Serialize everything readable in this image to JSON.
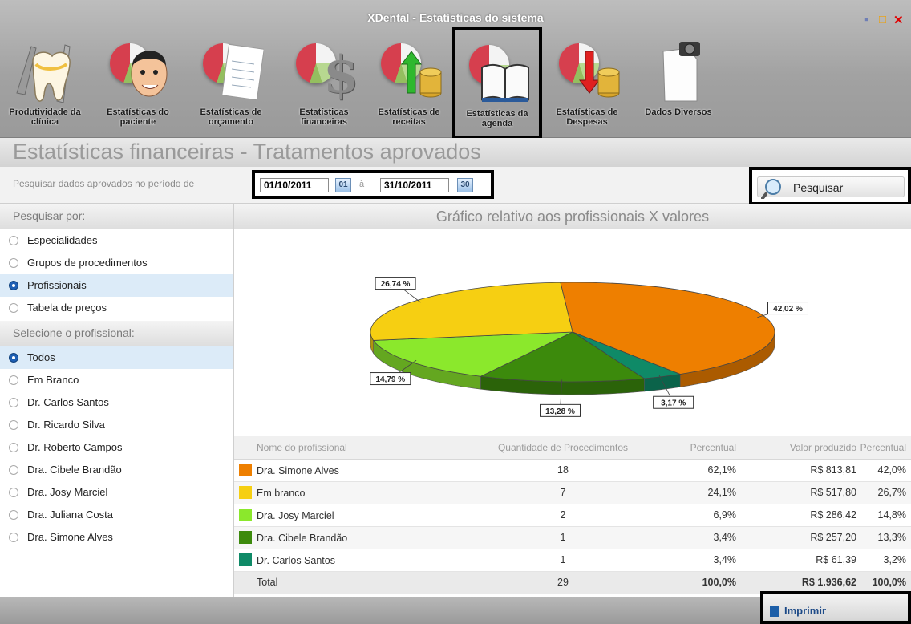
{
  "window": {
    "title": "XDental - Estatísticas do sistema"
  },
  "toolbar": {
    "items": [
      {
        "label": "Produtividade da clínica",
        "icon": "tooth-dental-icon"
      },
      {
        "label": "Estatísticas do paciente",
        "icon": "pie-patient-icon"
      },
      {
        "label": "Estatísticas de orçamento",
        "icon": "pie-budget-icon"
      },
      {
        "label": "Estatísticas financeiras",
        "icon": "pie-dollar-icon"
      },
      {
        "label": "Estatísticas de receitas",
        "icon": "pie-income-icon"
      },
      {
        "label": "Estatísticas da agenda",
        "icon": "pie-agenda-icon"
      },
      {
        "label": "Estatísticas de Despesas",
        "icon": "pie-expense-icon"
      },
      {
        "label": "Dados Diversos",
        "icon": "camera-document-icon"
      }
    ]
  },
  "section_title": "Estatísticas financeiras - Tratamentos aprovados",
  "search": {
    "label": "Pesquisar dados aprovados no período de",
    "date_from": "01/10/2011",
    "date_from_btn": "01",
    "separator": "à",
    "date_to": "31/10/2011",
    "date_to_btn": "30",
    "button": "Pesquisar"
  },
  "left": {
    "search_by_label": "Pesquisar por:",
    "search_by_options": [
      "Especialidades",
      "Grupos de procedimentos",
      "Profissionais",
      "Tabela de preços"
    ],
    "selected_search_by": "Profissionais",
    "select_prof_label": "Selecione o profissional:",
    "professionals": [
      "Todos",
      "Em Branco",
      "Dr. Carlos Santos",
      "Dr. Ricardo Silva",
      "Dr. Roberto Campos",
      "Dra. Cibele Brandão",
      "Dra. Josy Marciel",
      "Dra. Juliana Costa",
      "Dra. Simone Alves"
    ],
    "selected_professional": "Todos"
  },
  "chart_data": {
    "type": "pie",
    "title": "Gráfico relativo aos profissionais X valores",
    "slices": [
      {
        "name": "Dra. Simone Alves",
        "value": 42.02,
        "label": "42,02 %",
        "color": "#ee7f00"
      },
      {
        "name": "Dr. Carlos Santos",
        "value": 3.17,
        "label": "3,17 %",
        "color": "#0f8a67"
      },
      {
        "name": "Dra. Cibele Brandão",
        "value": 13.28,
        "label": "13,28 %",
        "color": "#3c8a0c"
      },
      {
        "name": "Dra. Josy Marciel",
        "value": 14.79,
        "label": "14,79 %",
        "color": "#8be82c"
      },
      {
        "name": "Em branco",
        "value": 26.74,
        "label": "26,74 %",
        "color": "#f6cf12"
      }
    ]
  },
  "table": {
    "headers": [
      "Nome do profissional",
      "Quantidade de Procedimentos",
      "Percentual",
      "Valor produzido",
      "Percentual"
    ],
    "rows": [
      {
        "name": "Dra. Simone Alves",
        "qty": "18",
        "pct": "62,1%",
        "value": "R$ 813,81",
        "pct2": "42,0%",
        "color": "#ee7f00"
      },
      {
        "name": "Em branco",
        "qty": "7",
        "pct": "24,1%",
        "value": "R$ 517,80",
        "pct2": "26,7%",
        "color": "#f6cf12"
      },
      {
        "name": "Dra. Josy Marciel",
        "qty": "2",
        "pct": "6,9%",
        "value": "R$ 286,42",
        "pct2": "14,8%",
        "color": "#8be82c"
      },
      {
        "name": "Dra. Cibele Brandão",
        "qty": "1",
        "pct": "3,4%",
        "value": "R$ 257,20",
        "pct2": "13,3%",
        "color": "#3c8a0c"
      },
      {
        "name": "Dr. Carlos Santos",
        "qty": "1",
        "pct": "3,4%",
        "value": "R$ 61,39",
        "pct2": "3,2%",
        "color": "#0f8a67"
      }
    ],
    "total": {
      "label": "Total",
      "qty": "29",
      "pct": "100,0%",
      "value": "R$ 1.936,62",
      "pct2": "100,0%"
    }
  },
  "footer": {
    "print_button": "Imprimir"
  }
}
